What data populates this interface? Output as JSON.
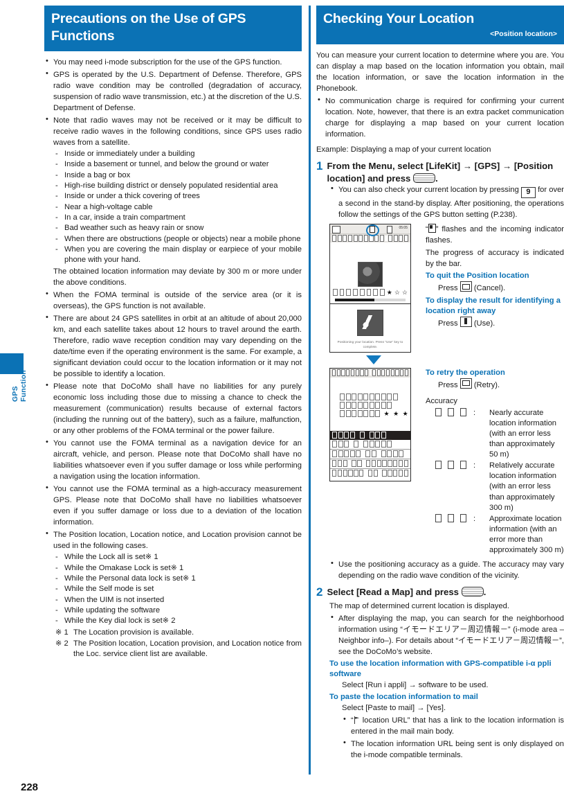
{
  "page": {
    "number": "228",
    "tab_label": "GPS Function",
    "accent": "#0b72b5"
  },
  "left": {
    "heading": "Precautions on the Use of GPS Functions",
    "bullets": [
      "You may need i-mode subscription for the use of the GPS function.",
      "GPS is operated by the U.S. Department of Defense. Therefore, GPS radio wave condition may be controlled (degradation of accuracy, suspension of radio wave transmission, etc.) at the discretion of the U.S. Department of Defense.",
      "Note that radio waves may not be received or it may be difficult to receive radio waves in the following conditions, since GPS uses radio waves from a satellite."
    ],
    "conditions": [
      "Inside or immediately under a building",
      "Inside a basement or tunnel, and below the ground or water",
      "Inside a bag or box",
      "High-rise building district or densely populated residential area",
      "Inside or under a thick covering of trees",
      "Near a high-voltage cable",
      "In a car, inside a train compartment",
      "Bad weather such as heavy rain or snow",
      "When there are obstructions (people or objects) near a mobile phone",
      "When you are covering the main display or earpiece of your mobile phone with your hand."
    ],
    "conditions_note": "The obtained location information may deviate by 300 m or more under the above conditions.",
    "bullets2": [
      "When the FOMA terminal is outside of the service area (or it is overseas), the GPS function is not available.",
      "There are about 24 GPS satellites in orbit at an altitude of about 20,000 km, and each satellite takes about 12 hours to travel around the earth. Therefore, radio wave reception condition may vary depending on the date/time even if the operating environment is the same. For example, a significant deviation could occur to the location information or it may not be possible to identify a location.",
      "Please note that DoCoMo shall have no liabilities for any purely economic loss including those due to missing a chance to check the measurement (communication) results because of external factors (including the running out of the battery), such as a failure, malfunction, or any other problems of the FOMA terminal or the power failure.",
      "You cannot use the FOMA terminal as a navigation device for an aircraft, vehicle, and person. Please note that DoCoMo shall have no liabilities whatsoever even if you suffer damage or loss while performing a navigation using the location information.",
      "You cannot use the FOMA terminal as a high-accuracy measurement GPS. Please note that DoCoMo shall have no liabilities whatsoever even if you suffer damage or loss due to a deviation of the location information.",
      "The Position location, Location notice, and Location provision cannot be used in the following cases."
    ],
    "cases": [
      "While the Lock all is set※ 1",
      "While the Omakase Lock is set※ 1",
      "While the Personal data lock is set※ 1",
      "While the Self mode is set",
      "When the UIM is not inserted",
      "While updating the software",
      "While the Key dial lock is set※ 2"
    ],
    "notes": [
      {
        "mark": "※ 1",
        "text": "The Location provision is available."
      },
      {
        "mark": "※ 2",
        "text": "The Position location, Location provision, and Location notice from the Loc. service client list are available."
      }
    ]
  },
  "right": {
    "heading": "Checking Your Location",
    "subheading": "<Position location>",
    "intro": "You can measure your current location to determine where you are. You can display a map based on the location information you obtain, mail the location information, or save the location information in the Phonebook.",
    "intro_bullet": "No communication charge is required for confirming your current location. Note, however, that there is an extra packet communication charge for displaying a map based on your current location information.",
    "example_line": "Example: Displaying a map of your current location",
    "step1": {
      "number": "1",
      "text_a": "From the Menu, select [LifeKit] → [GPS] → [Position location] and press",
      "text_b": ".",
      "bullet_a": "You can also check your current location by pressing",
      "key_label": "9",
      "bullet_b": "for over a second in the stand-by display. After positioning, the operations follow the settings of the GPS button setting (P.238)."
    },
    "shot1_caption_a": "“",
    "shot1_caption_b": "” flashes and the incoming indicator flashes.",
    "shot1_caption_c": "The progress of accuracy is indicated by the bar.",
    "quit_heading": "To quit the Position location",
    "quit_text_a": "Press",
    "quit_text_b": "(Cancel).",
    "display_heading": "To display the result for identifying a location right away",
    "display_text_a": "Press",
    "display_text_b": "(Use).",
    "retry_heading": "To retry the operation",
    "retry_text_a": "Press",
    "retry_text_b": "(Retry).",
    "accuracy_heading": "Accuracy",
    "accuracy_rows": [
      {
        "stars": "★★★",
        "text": "Nearly accurate location information (with an error less than approximately 50 m)"
      },
      {
        "stars": "★★☆",
        "text": "Relatively accurate location information (with an error less than approximately 300 m)"
      },
      {
        "stars": "★☆☆",
        "text": "Approximate location information (with an error more than approximately 300 m)"
      }
    ],
    "accuracy_bullet": "Use the positioning accuracy as a guide. The accuracy may vary depending on the radio wave condition of the vicinity.",
    "step2": {
      "number": "2",
      "text_a": "Select [Read a Map] and press",
      "text_b": ".",
      "desc": "The map of determined current location is displayed.",
      "bullet": "After displaying the map, you can search for the neighborhood information using “イモードエリア－周辺情報－” (i-mode area –Neighbor info–). For details about “イモードエリア－周辺情報－”, see the DoCoMo’s website."
    },
    "iappli_heading": "To use the location information with GPS-compatible i-α ppli software",
    "iappli_text": "Select [Run i appli] → software to be used.",
    "mail_heading": "To paste the location information to mail",
    "mail_text": "Select [Paste to mail] → [Yes].",
    "mail_bullets_a": "“",
    "mail_bullets_b": " location URL” that has a link to the location information is entered in the mail main body.",
    "mail_bullet2": "The location information URL being sent is only displayed on the i-mode compatible terminals."
  },
  "phone_screens": {
    "screen1_caption": "Positioning your location. Press “Use” key to complete.",
    "screen1_status_time": "05:05"
  }
}
